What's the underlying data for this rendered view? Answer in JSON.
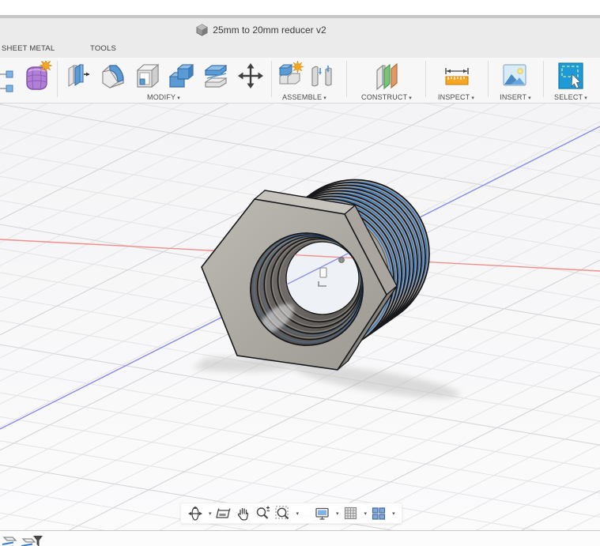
{
  "app": {
    "document_title": "25mm to 20mm reducer v2"
  },
  "tabs": {
    "sheet_metal": "SHEET METAL",
    "tools": "TOOLS"
  },
  "ribbon": {
    "caret": "▾",
    "groups": {
      "modify": "MODIFY",
      "assemble": "ASSEMBLE",
      "construct": "CONSTRUCT",
      "inspect": "INSPECT",
      "insert": "INSERT",
      "select": "SELECT"
    },
    "icon_names": [
      "create-partial-icon",
      "create-form-icon",
      "press-pull-icon",
      "fillet-icon",
      "shell-icon",
      "combine-icon",
      "offset-face-icon",
      "move-icon",
      "new-component-icon",
      "joint-icon",
      "construct-plane-icon",
      "measure-icon",
      "insert-image-icon",
      "select-icon"
    ]
  },
  "viewport": {
    "axis_x_color": "#ef8f8c",
    "axis_z_color": "#8a8aec",
    "selection_highlight_color": "#2f7cd2",
    "model_body_color": "#a6a29c"
  },
  "navbar": {
    "caret": "▾",
    "icon_names": [
      "orbit-icon",
      "look-at-icon",
      "pan-icon",
      "zoom-icon",
      "zoom-window-icon",
      "display-settings-icon",
      "grid-display-icon",
      "viewports-icon"
    ]
  },
  "statusbar": {
    "icon_names": [
      "section-view-icon",
      "section-filter-icon",
      "filter-icon"
    ]
  }
}
